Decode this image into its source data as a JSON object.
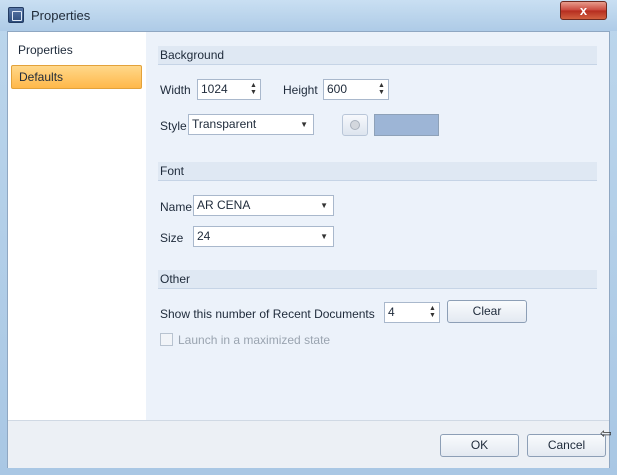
{
  "window": {
    "title": "Properties",
    "close_glyph": "x"
  },
  "nav": {
    "items": [
      {
        "label": "Properties"
      },
      {
        "label": "Defaults"
      }
    ]
  },
  "background": {
    "header": "Background",
    "width_label": "Width",
    "width_value": "1024",
    "height_label": "Height",
    "height_value": "600",
    "style_label": "Style",
    "style_value": "Transparent",
    "swatch_color": "#9db5d6"
  },
  "font": {
    "header": "Font",
    "name_label": "Name",
    "name_value": "AR CENA",
    "size_label": "Size",
    "size_value": "24"
  },
  "other": {
    "header": "Other",
    "recent_label": "Show this number of Recent Documents",
    "recent_value": "4",
    "clear_label": "Clear",
    "maximized_label": "Launch in a maximized state",
    "maximized_checked": false
  },
  "footer": {
    "ok_label": "OK",
    "cancel_label": "Cancel"
  },
  "colors": {
    "accent_selected": "#ffb84a",
    "close_button": "#c9463a"
  }
}
